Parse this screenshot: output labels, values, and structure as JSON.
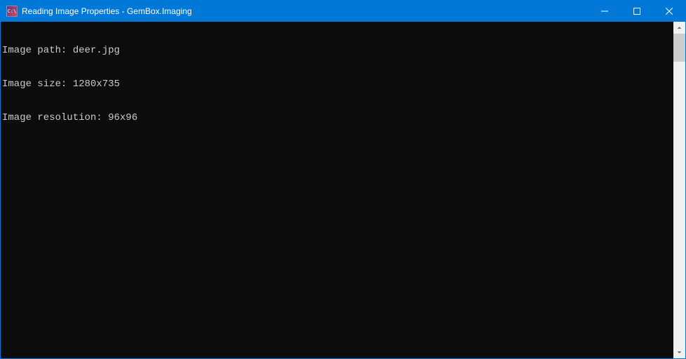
{
  "window": {
    "title": "Reading Image Properties - GemBox.Imaging",
    "icon_label": "C:\\"
  },
  "console": {
    "lines": [
      "Image path: deer.jpg",
      "Image size: 1280x735",
      "Image resolution: 96x96"
    ]
  }
}
